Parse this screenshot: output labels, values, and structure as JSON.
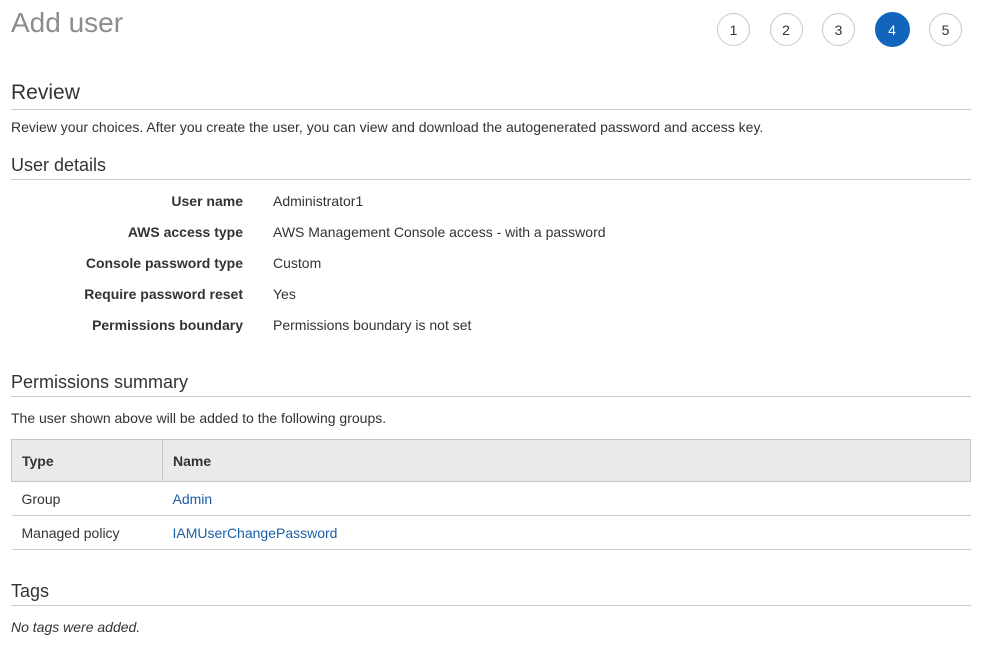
{
  "page": {
    "title": "Add user"
  },
  "steps": [
    {
      "label": "1",
      "active": false
    },
    {
      "label": "2",
      "active": false
    },
    {
      "label": "3",
      "active": false
    },
    {
      "label": "4",
      "active": true
    },
    {
      "label": "5",
      "active": false
    }
  ],
  "review": {
    "heading": "Review",
    "description": "Review your choices. After you create the user, you can view and download the autogenerated password and access key."
  },
  "user_details": {
    "heading": "User details",
    "rows": [
      {
        "label": "User name",
        "value": "Administrator1"
      },
      {
        "label": "AWS access type",
        "value": "AWS Management Console access - with a password"
      },
      {
        "label": "Console password type",
        "value": "Custom"
      },
      {
        "label": "Require password reset",
        "value": "Yes"
      },
      {
        "label": "Permissions boundary",
        "value": "Permissions boundary is not set"
      }
    ]
  },
  "permissions": {
    "heading": "Permissions summary",
    "description": "The user shown above will be added to the following groups.",
    "columns": [
      "Type",
      "Name"
    ],
    "rows": [
      {
        "type": "Group",
        "name": "Admin"
      },
      {
        "type": "Managed policy",
        "name": "IAMUserChangePassword"
      }
    ]
  },
  "tags": {
    "heading": "Tags",
    "empty_text": "No tags were added."
  },
  "colors": {
    "accent": "#1166bb",
    "link": "#1a5ea8",
    "title": "#8c8c8c"
  }
}
